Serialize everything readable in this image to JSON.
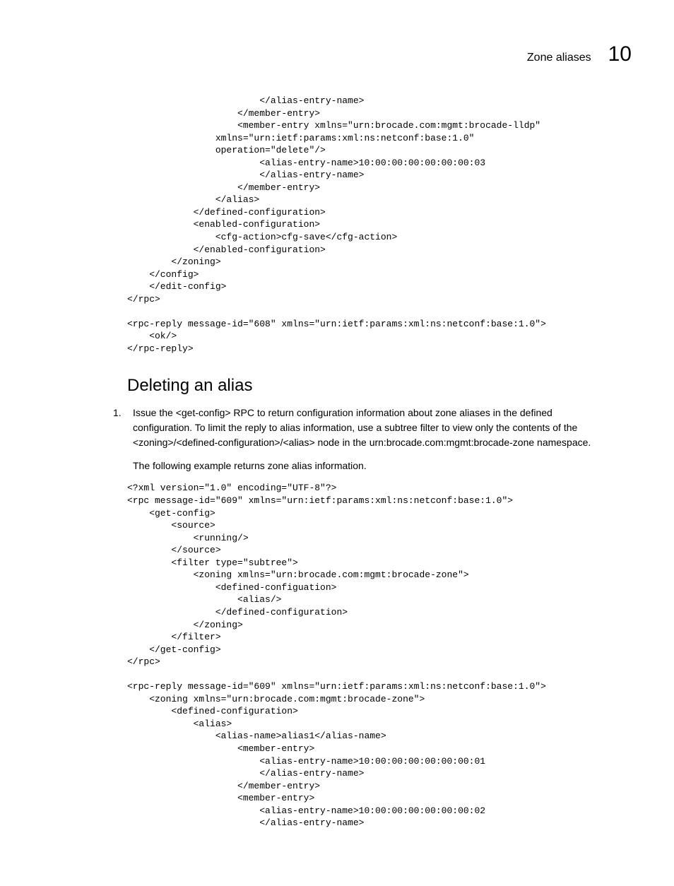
{
  "header": {
    "title": "Zone aliases",
    "chapter_number": "10"
  },
  "code_top": "                        </alias-entry-name>\n                    </member-entry>\n                    <member-entry xmlns=\"urn:brocade.com:mgmt:brocade-lldp\"\n                xmlns=\"urn:ietf:params:xml:ns:netconf:base:1.0\"\n                operation=\"delete\"/>\n                        <alias-entry-name>10:00:00:00:00:00:00:03\n                        </alias-entry-name>\n                    </member-entry>\n                </alias>\n            </defined-configuration>\n            <enabled-configuration>\n                <cfg-action>cfg-save</cfg-action>\n            </enabled-configuration>\n        </zoning>\n    </config>\n    </edit-config>\n</rpc>\n\n<rpc-reply message-id=\"608\" xmlns=\"urn:ietf:params:xml:ns:netconf:base:1.0\">\n    <ok/>\n</rpc-reply>",
  "section_heading": "Deleting an alias",
  "step1": {
    "marker": "1.",
    "text": "Issue the <get-config> RPC to return configuration information about zone aliases in the defined configuration. To limit the reply to alias information, use a subtree filter to view only the contents of the <zoning>/<defined-configuration>/<alias> node in the urn:brocade.com:mgmt:brocade-zone namespace."
  },
  "step1_followup": "The following example returns zone alias information.",
  "code_bottom": "<?xml version=\"1.0\" encoding=\"UTF-8\"?>\n<rpc message-id=\"609\" xmlns=\"urn:ietf:params:xml:ns:netconf:base:1.0\">\n    <get-config>\n        <source>\n            <running/>\n        </source>\n        <filter type=\"subtree\">\n            <zoning xmlns=\"urn:brocade.com:mgmt:brocade-zone\">\n                <defined-configuation>\n                    <alias/>\n                </defined-configuration>\n            </zoning>\n        </filter>\n    </get-config>\n</rpc>\n\n<rpc-reply message-id=\"609\" xmlns=\"urn:ietf:params:xml:ns:netconf:base:1.0\">\n    <zoning xmlns=\"urn:brocade.com:mgmt:brocade-zone\">\n        <defined-configuration>\n            <alias>\n                <alias-name>alias1</alias-name>\n                    <member-entry>\n                        <alias-entry-name>10:00:00:00:00:00:00:01\n                        </alias-entry-name>\n                    </member-entry>\n                    <member-entry>\n                        <alias-entry-name>10:00:00:00:00:00:00:02\n                        </alias-entry-name>"
}
